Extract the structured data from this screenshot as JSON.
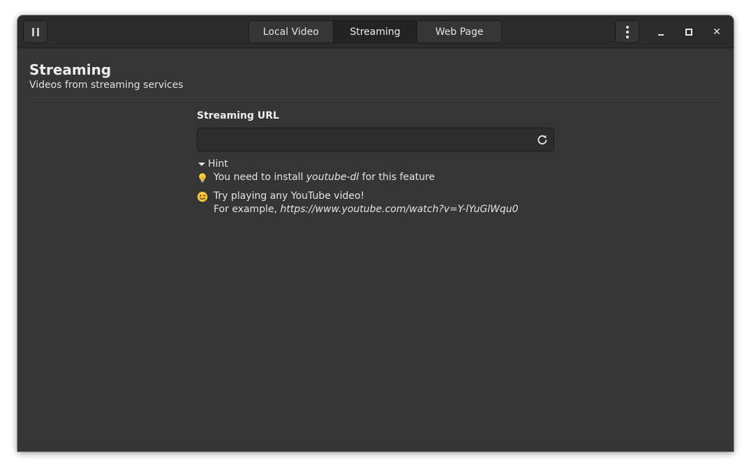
{
  "tabs": [
    {
      "label": "Local Video",
      "active": false
    },
    {
      "label": "Streaming",
      "active": true
    },
    {
      "label": "Web Page",
      "active": false
    }
  ],
  "page": {
    "title": "Streaming",
    "subtitle": "Videos from streaming services"
  },
  "form": {
    "url_label": "Streaming URL",
    "url_value": "",
    "url_placeholder": ""
  },
  "hint": {
    "toggle_label": "Hint",
    "expanded": true,
    "line1": {
      "icon": "lightbulb-icon",
      "prefix": "You need to install ",
      "emphasis": "youtube-dl",
      "suffix": " for this feature"
    },
    "line2": {
      "icon": "wink-emoji-icon",
      "text": "Try playing any YouTube video!",
      "example_prefix": "For example, ",
      "example_url": "https://www.youtube.com/watch?v=Y-lYuGlWqu0"
    }
  },
  "colors": {
    "window_bg": "#353535",
    "headerbar_bg": "#2b2b2b",
    "text": "#eeeeee",
    "active_tab_bg": "#232323"
  }
}
